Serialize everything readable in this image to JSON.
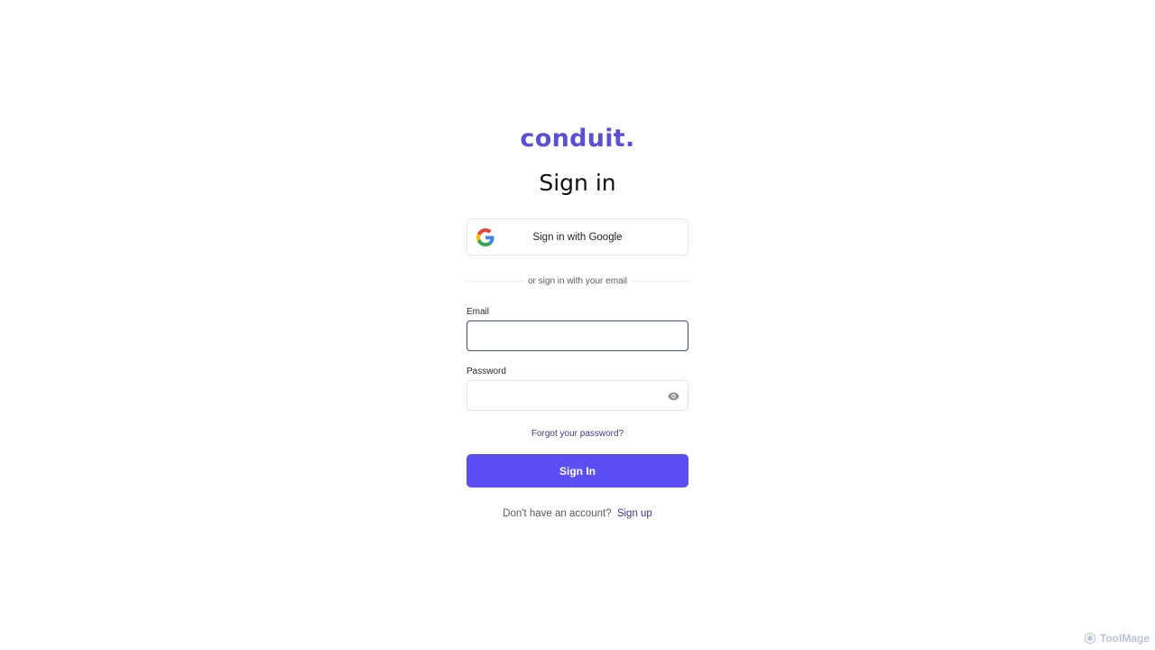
{
  "brand": {
    "logo_text": "conduit.",
    "accent_color": "#5b4ff3"
  },
  "page": {
    "title": "Sign in"
  },
  "google_button": {
    "label": "Sign in with Google",
    "icon": "google-icon"
  },
  "divider": {
    "text": "or sign in with your email"
  },
  "form": {
    "email": {
      "label": "Email",
      "value": "",
      "placeholder": ""
    },
    "password": {
      "label": "Password",
      "value": "",
      "placeholder": "",
      "toggle_icon": "eye-icon"
    },
    "forgot_link": "Forgot your password?",
    "submit_label": "Sign In"
  },
  "footer": {
    "prompt": "Don't have an account?",
    "signup_link": "Sign up"
  },
  "watermark": {
    "text": "ToolMage"
  }
}
